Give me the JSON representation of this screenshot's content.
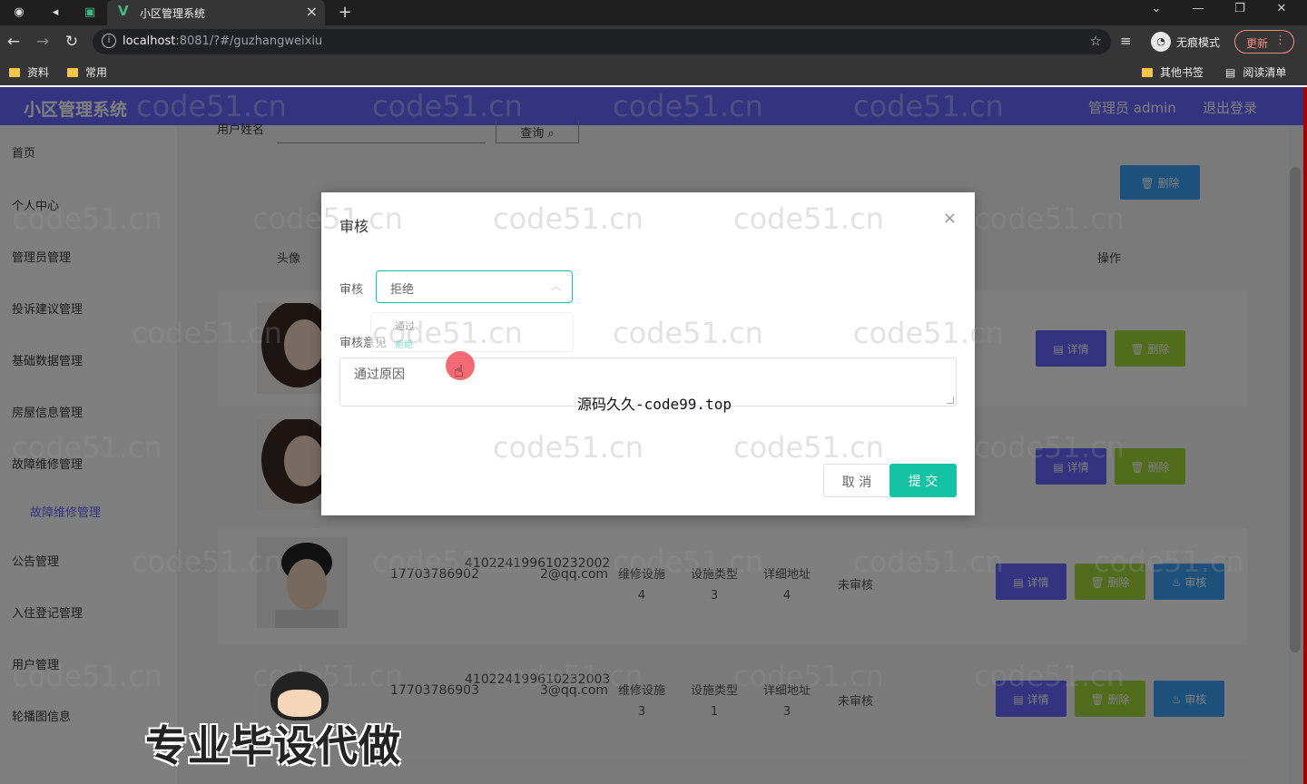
{
  "browser": {
    "tab_title": "小区管理系统",
    "tab_logo": "V",
    "url_host": "localhost",
    "url_rest": ":8081/?#/guzhangweixiu",
    "incognito_label": "无痕模式",
    "update_label": "更新",
    "bookmarks": [
      "资料",
      "常用"
    ],
    "bookmarks_right": [
      "其他书签",
      "阅读清单"
    ]
  },
  "app": {
    "title": "小区管理系统",
    "user": "管理员 admin",
    "logout": "退出登录"
  },
  "sidebar": {
    "items": [
      "首页",
      "个人中心",
      "管理员管理",
      "投诉建议管理",
      "基础数据管理",
      "房屋信息管理",
      "故障维修管理",
      "故障维修管理",
      "公告管理",
      "入住登记管理",
      "用户管理",
      "轮播图信息"
    ]
  },
  "search": {
    "label": "用户姓名",
    "button": "查询"
  },
  "toolbar": {
    "delete": "删除"
  },
  "table": {
    "headers": [
      "头像",
      "操作"
    ],
    "buttons": {
      "detail": "详情",
      "delete": "删除",
      "audit": "审核"
    },
    "rows": [
      {
        "phone": "17703786902",
        "idcard": "410224199610232002",
        "email": "2@qq.com",
        "facility": "维修设施4",
        "type": "设施类型3",
        "address": "详细地址4",
        "status": "未审核"
      },
      {
        "phone": "17703786903",
        "idcard": "410224199610232003",
        "email": "3@qq.com",
        "facility": "维修设施3",
        "type": "设施类型1",
        "address": "详细地址3",
        "status": "未审核"
      }
    ]
  },
  "dialog": {
    "title": "审核",
    "field_audit_label": "审核",
    "selected": "拒绝",
    "options": [
      "通过",
      "拒绝"
    ],
    "field_opinion_label": "审核意见",
    "opinion_placeholder": "通过原因",
    "cancel": "取 消",
    "submit": "提 交"
  },
  "overlays": {
    "watermark": "code51.cn",
    "source_text": "源码久久-code99.top",
    "promo": "专业毕设代做"
  },
  "colors": {
    "header": "#6666ff",
    "primary": "#16c2a4",
    "detail": "#6666ff",
    "delete": "#a4d93c",
    "audit": "#3aa2f8"
  }
}
